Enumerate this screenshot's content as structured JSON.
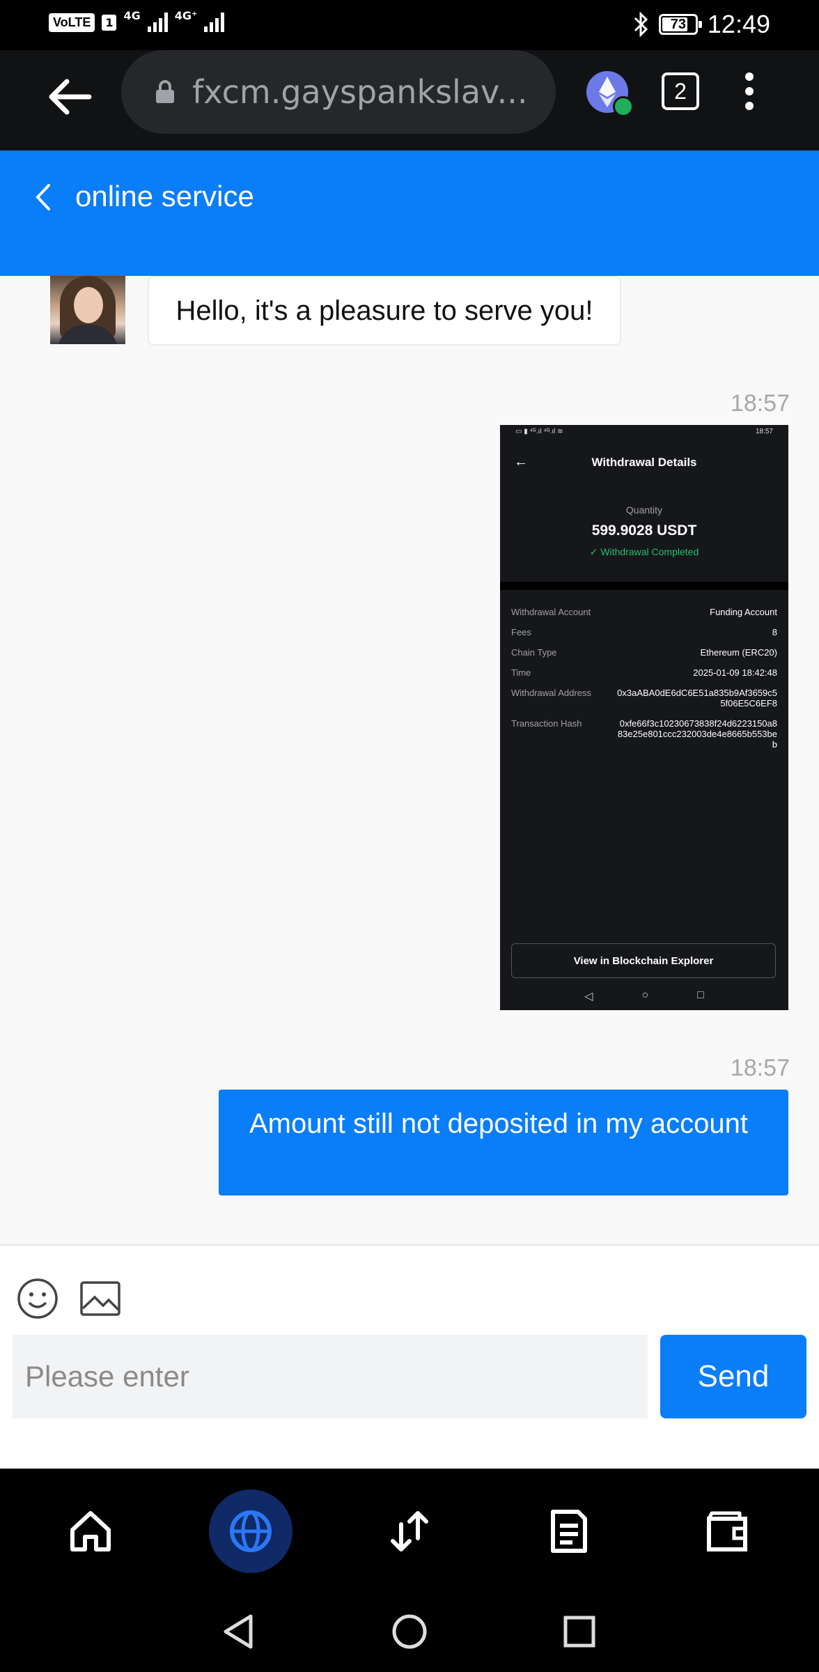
{
  "status_bar": {
    "volte": "VoLTE",
    "sim": "1",
    "net1": "4G",
    "net2": "4G⁺",
    "battery": "73",
    "time": "12:49"
  },
  "browser": {
    "url": "fxcm.gayspankslav...",
    "tab_count": "2"
  },
  "header": {
    "title": "online service"
  },
  "chat": {
    "greeting": "Hello, it's a pleasure to serve you!",
    "timestamp1": "18:57",
    "timestamp2": "18:57",
    "user_message": "Amount still not deposited in my account",
    "attached_screenshot": {
      "status_time": "18:57",
      "title": "Withdrawal Details",
      "quantity_label": "Quantity",
      "quantity": "599.9028 USDT",
      "status": "Withdrawal Completed",
      "rows": [
        {
          "key": "Withdrawal Account",
          "value": "Funding Account"
        },
        {
          "key": "Fees",
          "value": "8"
        },
        {
          "key": "Chain Type",
          "value": "Ethereum (ERC20)"
        },
        {
          "key": "Time",
          "value": "2025-01-09 18:42:48"
        },
        {
          "key": "Withdrawal Address",
          "value": "0x3aABA0dE6dC6E51a835b9Af3659c55f06E5C6EF8"
        },
        {
          "key": "Transaction Hash",
          "value": "0xfe66f3c10230673838f24d6223150a883e25e801ccc232003de4e8665b553beb"
        }
      ],
      "explorer_button": "View in Blockchain Explorer"
    }
  },
  "input": {
    "placeholder": "Please enter",
    "send_label": "Send"
  },
  "colors": {
    "accent": "#0a7df9",
    "success": "#22c06a"
  }
}
